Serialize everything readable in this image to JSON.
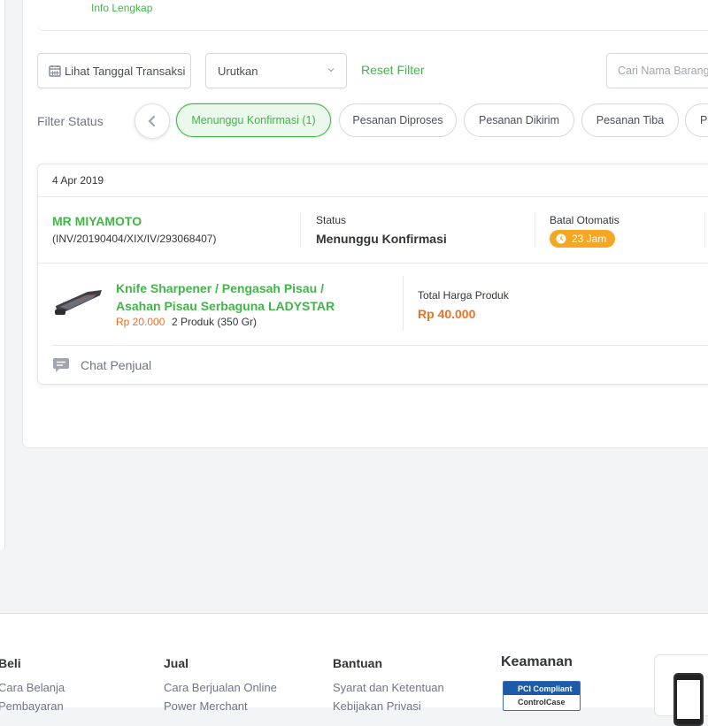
{
  "header": {
    "info_link": "Info Lengkap"
  },
  "filters": {
    "date_button": "Lihat Tanggal Transaksi",
    "sort_select": "Urutkan",
    "reset": "Reset Filter",
    "search_placeholder": "Cari Nama Barang",
    "status_label": "Filter Status",
    "chips": [
      {
        "label": "Menunggu Konfirmasi (1)",
        "active": true
      },
      {
        "label": "Pesanan Diproses",
        "active": false
      },
      {
        "label": "Pesanan Dikirim",
        "active": false
      },
      {
        "label": "Pesanan Tiba",
        "active": false
      },
      {
        "label": "Pe",
        "active": false
      }
    ]
  },
  "order": {
    "date": "4 Apr 2019",
    "shop_name": "MR MIYAMOTO",
    "invoice": "(INV/20190404/XIX/IV/293068407)",
    "status_label": "Status",
    "status_value": "Menunggu Konfirmasi",
    "auto_cancel_label": "Batal Otomatis",
    "auto_cancel_value": "23 Jam",
    "product": {
      "name": "Knife Sharpener / Pengasah Pisau / Asahan Pisau Serbaguna LADYSTAR",
      "price": "Rp 20.000",
      "quantity": "2 Produk (350 Gr)"
    },
    "total_label": "Total Harga Produk",
    "total_value": "Rp 40.000",
    "chat": "Chat Penjual"
  },
  "footer": {
    "beli": {
      "title": "Beli",
      "links": [
        "Cara Belanja",
        "Pembayaran"
      ]
    },
    "jual": {
      "title": "Jual",
      "links": [
        "Cara Berjualan Online",
        "Power Merchant"
      ]
    },
    "bantuan": {
      "title": "Bantuan",
      "links": [
        "Syarat dan Ketentuan",
        "Kebijakan Privasi"
      ]
    },
    "keamanan": {
      "title": "Keamanan",
      "badge_top": "PCI Compliant",
      "badge_bottom": "ControlCase"
    }
  },
  "colors": {
    "accent": "#42b549",
    "price": "#f37021",
    "timer": "#f5a623"
  }
}
